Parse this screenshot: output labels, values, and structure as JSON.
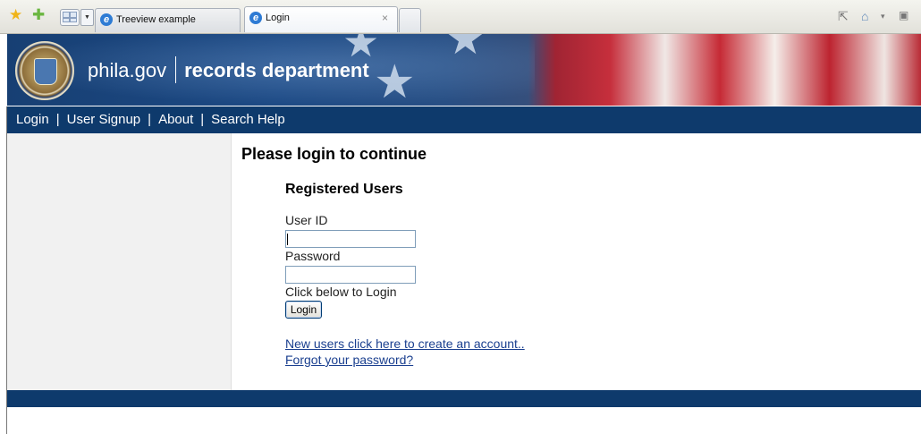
{
  "browser": {
    "tabs": [
      {
        "label": "Treeview example",
        "active": false
      },
      {
        "label": "Login",
        "active": true
      }
    ],
    "close_glyph": "×"
  },
  "header": {
    "site": "phila.gov",
    "department": "records department"
  },
  "nav": {
    "items": [
      "Login",
      "User Signup",
      "About",
      "Search Help"
    ],
    "separator": "|"
  },
  "main": {
    "title": "Please login to continue",
    "section_title": "Registered Users",
    "user_id_label": "User ID",
    "user_id_value": "",
    "password_label": "Password",
    "password_value": "",
    "instruction": "Click below to Login",
    "login_button": "Login",
    "signup_link": "New users click here to create an account..",
    "forgot_link": "Forgot your password?"
  },
  "colors": {
    "nav_bg": "#0e3a6c",
    "link": "#1a3f8f",
    "sidebar_bg": "#f1f1f1"
  }
}
